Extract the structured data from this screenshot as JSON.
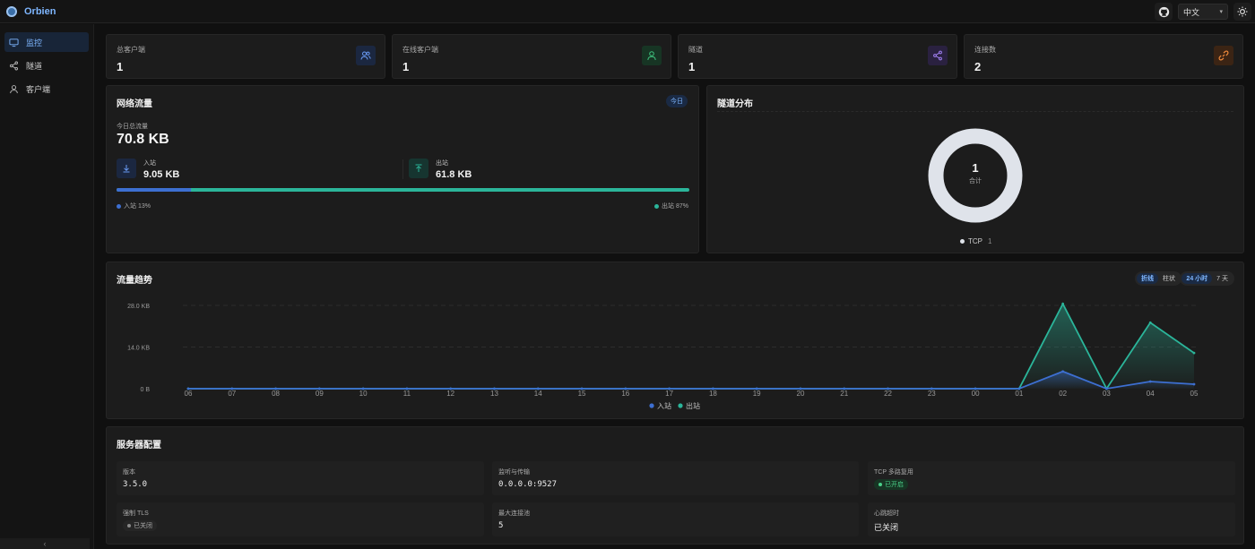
{
  "app": {
    "name": "Orbien"
  },
  "topbar": {
    "language": "中文"
  },
  "sidebar": {
    "items": [
      {
        "label": "监控",
        "icon": "monitor-icon",
        "active": true
      },
      {
        "label": "隧道",
        "icon": "share-icon",
        "active": false
      },
      {
        "label": "客户端",
        "icon": "user-icon",
        "active": false
      }
    ]
  },
  "stats": [
    {
      "label": "总客户端",
      "value": "1",
      "icon": "users-icon",
      "color": "#3d6fd1"
    },
    {
      "label": "在线客户端",
      "value": "1",
      "icon": "user-icon",
      "color": "#2ea36a"
    },
    {
      "label": "隧道",
      "value": "1",
      "icon": "share-icon",
      "color": "#8a63d2"
    },
    {
      "label": "连接数",
      "value": "2",
      "icon": "link-icon",
      "color": "#e0742c"
    }
  ],
  "traffic": {
    "title": "网络流量",
    "badge": "今日",
    "total_label": "今日总流量",
    "total_value": "70.8 KB",
    "inbound": {
      "label": "入站",
      "value": "9.05 KB",
      "legend": "入站 13%",
      "share": 0.13,
      "color": "#3d6fd1"
    },
    "outbound": {
      "label": "出站",
      "value": "61.8 KB",
      "legend": "出站 87%",
      "share": 0.87,
      "color": "#2bb59a"
    }
  },
  "distribution": {
    "title": "隧道分布",
    "center_value": "1",
    "center_label": "合计",
    "legend": [
      {
        "name": "TCP",
        "value": "1",
        "color": "#dfe3ea"
      }
    ]
  },
  "trend": {
    "title": "流量趋势",
    "chart_toggle": [
      "折线",
      "柱状"
    ],
    "chart_toggle_active": 0,
    "range_toggle": [
      "24 小时",
      "7 天"
    ],
    "range_toggle_active": 0
  },
  "chart_data": {
    "type": "area",
    "title": "流量趋势",
    "categories": [
      "06",
      "07",
      "08",
      "09",
      "10",
      "11",
      "12",
      "13",
      "14",
      "15",
      "16",
      "17",
      "18",
      "19",
      "20",
      "21",
      "22",
      "23",
      "00",
      "01",
      "02",
      "03",
      "04",
      "05"
    ],
    "y_ticks": [
      "0 B",
      "14.0 KB",
      "28.0 KB"
    ],
    "ylim": [
      0,
      31
    ],
    "y_unit": "KB",
    "grid": true,
    "legend_position": "bottom-center",
    "series": [
      {
        "name": "入站",
        "color": "#3d6fd1",
        "values": [
          0,
          0,
          0,
          0,
          0,
          0,
          0,
          0,
          0,
          0,
          0,
          0,
          0,
          0,
          0,
          0,
          0,
          0,
          0,
          0,
          5.8,
          0,
          2.4,
          1.5
        ]
      },
      {
        "name": "出站",
        "color": "#2bb59a",
        "values": [
          0,
          0,
          0,
          0,
          0,
          0,
          0,
          0,
          0,
          0,
          0,
          0,
          0,
          0,
          0,
          0,
          0,
          0,
          0,
          0,
          28.5,
          0,
          22.2,
          12.0
        ]
      }
    ]
  },
  "server_config": {
    "title": "服务器配置",
    "items": [
      {
        "label": "版本",
        "value": "3.5.0",
        "kind": "text"
      },
      {
        "label": "监听与传输",
        "value": "0.0.0.0:9527",
        "kind": "text"
      },
      {
        "label": "TCP 多路复用",
        "value": "已开启",
        "kind": "badge-on"
      },
      {
        "label": "强制 TLS",
        "value": "已关闭",
        "kind": "badge-off"
      },
      {
        "label": "最大连接池",
        "value": "5",
        "kind": "text"
      },
      {
        "label": "心跳超时",
        "value": "已关闭",
        "kind": "text"
      }
    ]
  }
}
